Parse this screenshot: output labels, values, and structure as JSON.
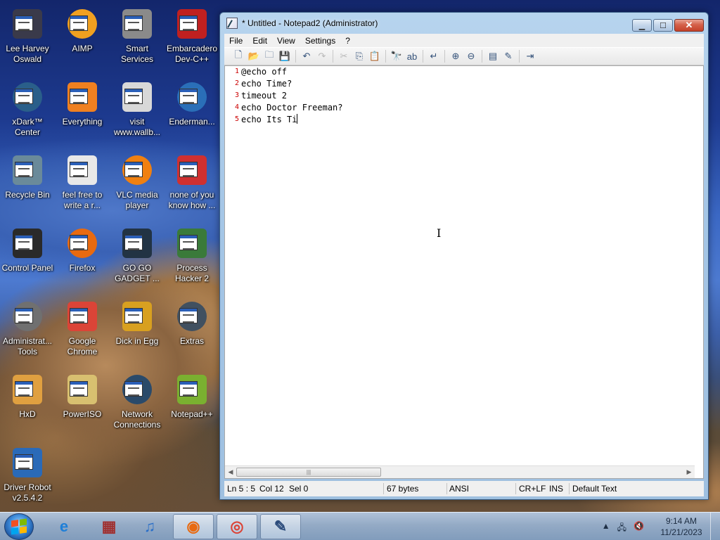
{
  "desktop": {
    "icons": [
      {
        "label": "Lee Harvey\nOswald",
        "icon": "character-icon",
        "color": "#3a3a4a"
      },
      {
        "label": "AIMP",
        "icon": "aimp-icon",
        "color": "#f0a020"
      },
      {
        "label": "Smart\nServices",
        "icon": "gears-icon",
        "color": "#8a8a8a"
      },
      {
        "label": "Embarcadero\nDev-C++",
        "icon": "devcpp-icon",
        "color": "#c02020"
      },
      {
        "label": "xDark™\nCenter",
        "icon": "xdark-icon",
        "color": "#2a5f8a"
      },
      {
        "label": "Everything",
        "icon": "search-icon",
        "color": "#f08020"
      },
      {
        "label": "visit\nwww.wallb...",
        "icon": "document-icon",
        "color": "#d8d8d8"
      },
      {
        "label": "Enderman...",
        "icon": "window-icon",
        "color": "#2a6fb8"
      },
      {
        "label": "Recycle Bin",
        "icon": "recycle-bin-icon",
        "color": "#6a8a9a"
      },
      {
        "label": "feel free to\nwrite a r...",
        "icon": "text-file-icon",
        "color": "#e8e8e8"
      },
      {
        "label": "VLC media\nplayer",
        "icon": "vlc-icon",
        "color": "#f08010"
      },
      {
        "label": "none of you\nknow how ...",
        "icon": "app-icon",
        "color": "#d03030"
      },
      {
        "label": "Control Panel",
        "icon": "control-panel-icon",
        "color": "#2a2a2a"
      },
      {
        "label": "Firefox",
        "icon": "firefox-icon",
        "color": "#e86a10"
      },
      {
        "label": "GO GO\nGADGET ...",
        "icon": "gadget-icon",
        "color": "#223344"
      },
      {
        "label": "Process\nHacker 2",
        "icon": "process-hacker-icon",
        "color": "#3a7a3a"
      },
      {
        "label": "Administrat...\nTools",
        "icon": "admin-tools-icon",
        "color": "#707070"
      },
      {
        "label": "Google\nChrome",
        "icon": "chrome-icon",
        "color": "#db4437"
      },
      {
        "label": "Dick in Egg",
        "icon": "egg-icon",
        "color": "#d8a020"
      },
      {
        "label": "Extras",
        "icon": "extras-icon",
        "color": "#405060"
      },
      {
        "label": "HxD",
        "icon": "hxd-icon",
        "color": "#e0a040"
      },
      {
        "label": "PowerISO",
        "icon": "disc-icon",
        "color": "#d8c070"
      },
      {
        "label": "Network\nConnections",
        "icon": "network-icon",
        "color": "#2a4a6a"
      },
      {
        "label": "Notepad++",
        "icon": "notepadpp-icon",
        "color": "#7ab030"
      },
      {
        "label": "Driver Robot\nv2.5.4.2",
        "icon": "driver-robot-icon",
        "color": "#2a6ab8"
      }
    ]
  },
  "window": {
    "title": "* Untitled - Notepad2 (Administrator)",
    "menu": [
      "File",
      "Edit",
      "View",
      "Settings",
      "?"
    ],
    "toolbar": [
      {
        "icon": "new-file-icon",
        "glyph": "🗋",
        "enabled": true
      },
      {
        "icon": "open-folder-icon",
        "glyph": "📂",
        "enabled": true
      },
      {
        "icon": "browse-icon",
        "glyph": "🗀",
        "enabled": true
      },
      {
        "icon": "save-icon",
        "glyph": "💾",
        "enabled": true
      },
      {
        "sep": true
      },
      {
        "icon": "undo-icon",
        "glyph": "↶",
        "enabled": true
      },
      {
        "icon": "redo-icon",
        "glyph": "↷",
        "enabled": false
      },
      {
        "sep": true
      },
      {
        "icon": "cut-icon",
        "glyph": "✂",
        "enabled": false
      },
      {
        "icon": "copy-icon",
        "glyph": "⎘",
        "enabled": true
      },
      {
        "icon": "paste-icon",
        "glyph": "📋",
        "enabled": true
      },
      {
        "sep": true
      },
      {
        "icon": "find-icon",
        "glyph": "🔭",
        "enabled": true
      },
      {
        "icon": "replace-icon",
        "glyph": "ab",
        "enabled": true
      },
      {
        "sep": true
      },
      {
        "icon": "word-wrap-icon",
        "glyph": "↵",
        "enabled": true
      },
      {
        "sep": true
      },
      {
        "icon": "zoom-in-icon",
        "glyph": "⊕",
        "enabled": true
      },
      {
        "icon": "zoom-out-icon",
        "glyph": "⊖",
        "enabled": true
      },
      {
        "sep": true
      },
      {
        "icon": "scheme-icon",
        "glyph": "▤",
        "enabled": true
      },
      {
        "icon": "customize-scheme-icon",
        "glyph": "✎",
        "enabled": true
      },
      {
        "sep": true
      },
      {
        "icon": "exit-icon",
        "glyph": "⇥",
        "enabled": true
      }
    ],
    "lines": [
      "@echo off",
      "echo Time?",
      "timeout 2",
      "echo Doctor Freeman?",
      "echo Its Ti"
    ],
    "line_numbers": [
      "1",
      "2",
      "3",
      "4",
      "5"
    ],
    "status": {
      "position": "Ln 5 : 5",
      "column": "Col 12",
      "selection": "Sel 0",
      "size": "67 bytes",
      "encoding": "ANSI",
      "line_endings": "CR+LF",
      "mode": "INS",
      "scheme": "Default Text"
    },
    "scroll_grip": "|||"
  },
  "taskbar": {
    "buttons": [
      {
        "name": "ie",
        "icon": "internet-explorer-icon",
        "glyph": "e",
        "color": "#1e7fd8",
        "active": false
      },
      {
        "name": "archive",
        "icon": "archive-icon",
        "glyph": "▦",
        "color": "#a03030",
        "active": false
      },
      {
        "name": "music",
        "icon": "music-note-icon",
        "glyph": "♫",
        "color": "#2a6fc8",
        "active": false
      },
      {
        "name": "firefox",
        "icon": "firefox-icon",
        "glyph": "◉",
        "color": "#e86a10",
        "active": true
      },
      {
        "name": "chrome",
        "icon": "chrome-icon",
        "glyph": "◎",
        "color": "#db4437",
        "active": true
      },
      {
        "name": "notepad2",
        "icon": "notepad2-icon",
        "glyph": "✎",
        "color": "#2a4a7a",
        "active": true
      }
    ],
    "tray": {
      "arrow": "▲",
      "network": "🖧",
      "volume": "🔇"
    },
    "clock": {
      "time": "9:14 AM",
      "date": "11/21/2023"
    }
  }
}
